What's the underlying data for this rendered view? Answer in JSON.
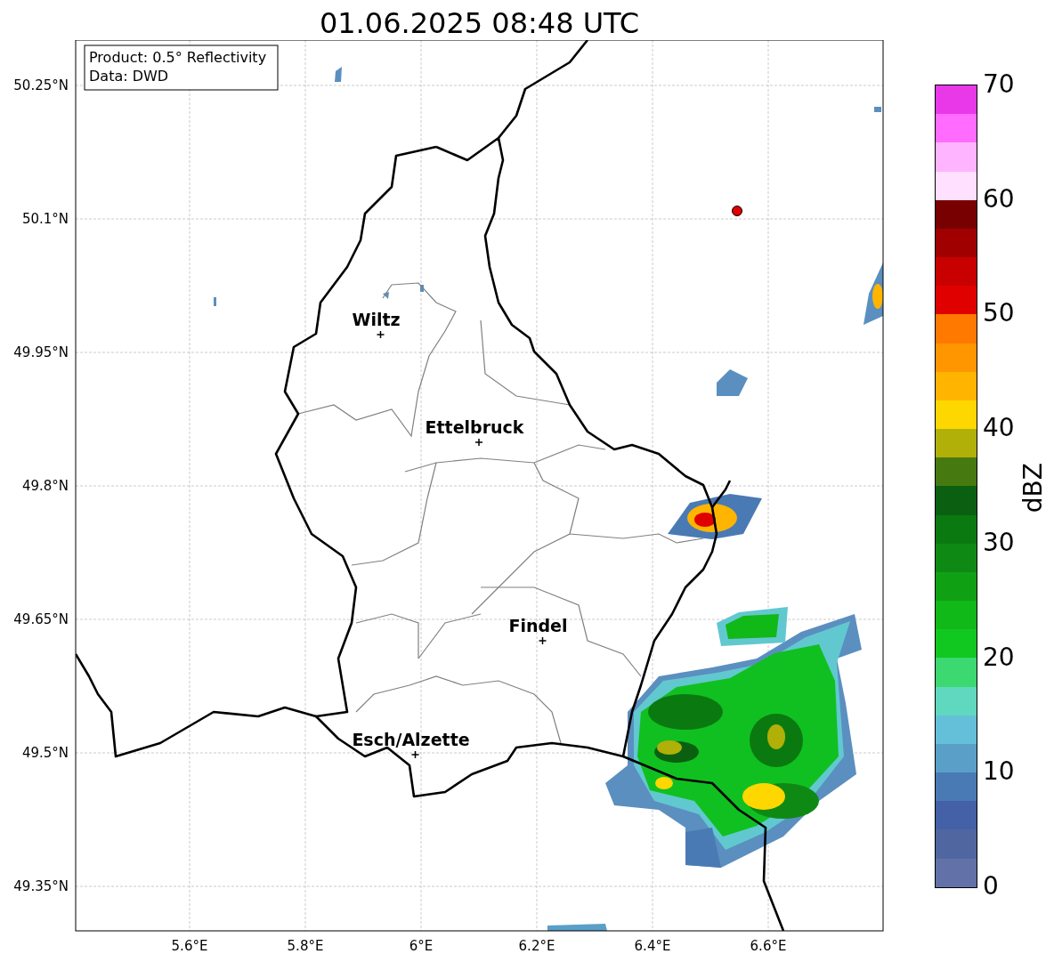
{
  "title": "01.06.2025 08:48 UTC",
  "info_box": [
    "Product: 0.5° Reflectivity",
    "Data: DWD"
  ],
  "map": {
    "lat_ticks": [
      "50.25°N",
      "50.1°N",
      "49.95°N",
      "49.8°N",
      "49.65°N",
      "49.5°N",
      "49.35°N"
    ],
    "lon_ticks": [
      "5.6°E",
      "5.8°E",
      "6°E",
      "6.2°E",
      "6.4°E",
      "6.6°E"
    ],
    "cities": [
      {
        "name": "Wiltz"
      },
      {
        "name": "Ettelbruck"
      },
      {
        "name": "Findel"
      },
      {
        "name": "Esch/Alzette"
      }
    ]
  },
  "colorbar": {
    "label": "dBZ",
    "ticks": [
      "70",
      "60",
      "50",
      "40",
      "30",
      "20",
      "10",
      "0"
    ],
    "bands": [
      {
        "color": "#e838e8"
      },
      {
        "color": "#ff6cff"
      },
      {
        "color": "#ffb4ff"
      },
      {
        "color": "#ffe0ff"
      },
      {
        "color": "#780000"
      },
      {
        "color": "#a00000"
      },
      {
        "color": "#c80000"
      },
      {
        "color": "#e00000"
      },
      {
        "color": "#ff7800"
      },
      {
        "color": "#ff9600"
      },
      {
        "color": "#ffb400"
      },
      {
        "color": "#ffd700"
      },
      {
        "color": "#b0b008"
      },
      {
        "color": "#467a10"
      },
      {
        "color": "#0a6010"
      },
      {
        "color": "#0a7a10"
      },
      {
        "color": "#0e8a14"
      },
      {
        "color": "#10a014"
      },
      {
        "color": "#10b818"
      },
      {
        "color": "#10c820"
      },
      {
        "color": "#3cd870"
      },
      {
        "color": "#60d8c0"
      },
      {
        "color": "#64c0d8"
      },
      {
        "color": "#5a9fc8"
      },
      {
        "color": "#4a7ab4"
      },
      {
        "color": "#4460a6"
      },
      {
        "color": "#5066a0"
      },
      {
        "color": "#6272a8"
      }
    ]
  }
}
